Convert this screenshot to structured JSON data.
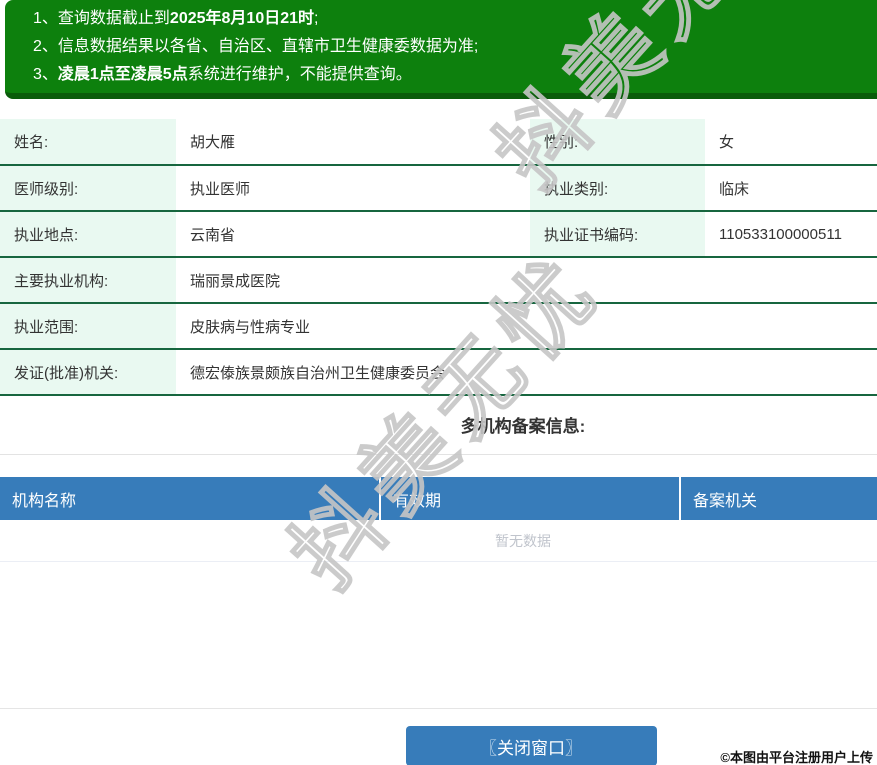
{
  "notices": {
    "items": [
      {
        "num": "1、",
        "pre": "查询数据截止到",
        "bold": "2025年8月10日21时",
        "post": ";"
      },
      {
        "num": "2、",
        "pre": "信息数据结果以各省、自治区、直辖市卫生健康委数据为准;",
        "bold": "",
        "post": ""
      },
      {
        "num": "3、",
        "pre": "",
        "bold": "凌晨1点至凌晨5点",
        "post": "系统进行维护，不能提供查询。"
      }
    ]
  },
  "info": {
    "name_label": "姓名:",
    "name_value": "胡大雁",
    "gender_label": "性别:",
    "gender_value": "女",
    "level_label": "医师级别:",
    "level_value": "执业医师",
    "category_label": "执业类别:",
    "category_value": "临床",
    "location_label": "执业地点:",
    "location_value": "云南省",
    "cert_label": "执业证书编码:",
    "cert_value": "110533100000511",
    "org_label": "主要执业机构:",
    "org_value": "瑞丽景成医院",
    "scope_label": "执业范围:",
    "scope_value": "皮肤病与性病专业",
    "issuer_label": "发证(批准)机关:",
    "issuer_value": "德宏傣族景颇族自治州卫生健康委员会"
  },
  "records": {
    "section_title": "多机构备案信息:",
    "headers": [
      "机构名称",
      "有效期",
      "备案机关"
    ],
    "empty_text": "暂无数据"
  },
  "footer": {
    "close_button_label": "〖关闭窗口〗",
    "copyright": "©本图由平台注册用户上传"
  },
  "watermark": {
    "text": "抖美无忧"
  },
  "colors": {
    "banner_green": "#0d800d",
    "banner_green_dark": "#0a5c0a",
    "label_mint": "#e9f9f1",
    "row_line_green": "#17663f",
    "header_blue": "#377cba",
    "empty_gray": "#c0c4cc"
  }
}
